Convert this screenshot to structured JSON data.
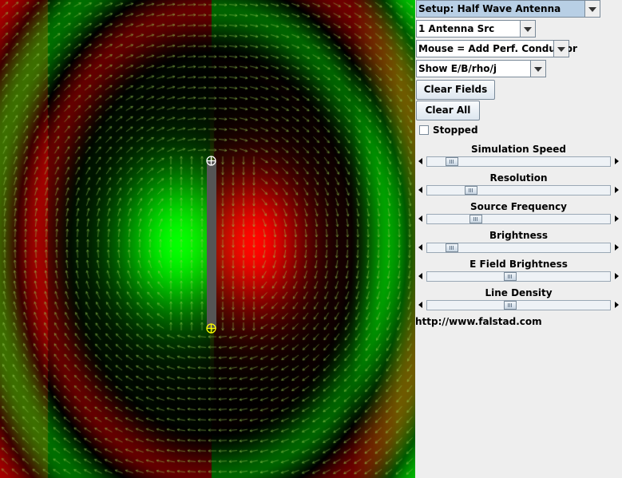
{
  "setup_select": {
    "value": "Setup: Half Wave Antenna"
  },
  "source_select": {
    "value": "1 Antenna Src"
  },
  "mouse_select": {
    "value": "Mouse = Add Perf. Conductor"
  },
  "show_select": {
    "value": "Show E/B/rho/j"
  },
  "buttons": {
    "clear_fields": "Clear Fields",
    "clear_all": "Clear All"
  },
  "stopped": {
    "label": "Stopped",
    "checked": false
  },
  "sliders": [
    {
      "label": "Simulation Speed",
      "value": 0.11
    },
    {
      "label": "Resolution",
      "value": 0.22
    },
    {
      "label": "Source Frequency",
      "value": 0.25
    },
    {
      "label": "Brightness",
      "value": 0.11
    },
    {
      "label": "E Field Brightness",
      "value": 0.45
    },
    {
      "label": "Line Density",
      "value": 0.45
    }
  ],
  "url": "http://www.falstad.com",
  "colors": {
    "positive": "#ff0000",
    "negative": "#00ff00",
    "panel_bg": "#eeeeee",
    "accent": "#b8cfe5"
  },
  "icons": {
    "antenna_top": "crosshair-circle-icon",
    "antenna_bottom": "crosshair-circle-icon"
  }
}
